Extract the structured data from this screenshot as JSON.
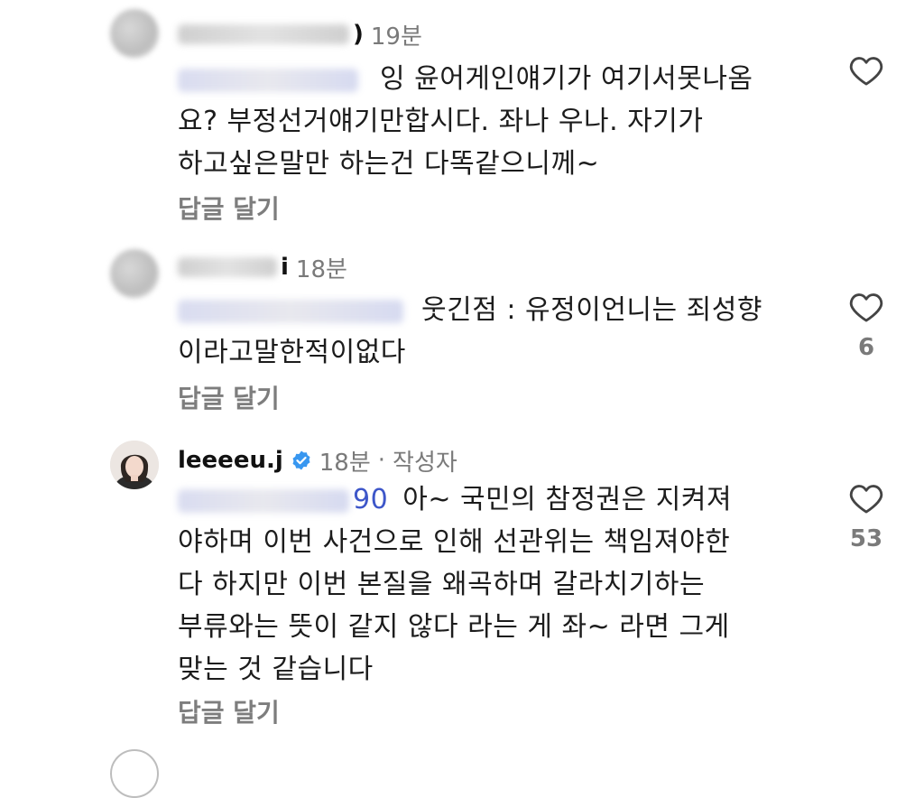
{
  "comments": [
    {
      "username_tail": ")",
      "time": "19분",
      "text_lines": [
        "잉 윤어게인얘기가 여기서못나옴",
        "요?  부정선거얘기만합시다.  좌나 우나. 자기가",
        "하고싶은말만 하는건 다똑같으니께~"
      ],
      "reply_label": "답글 달기",
      "like_count": ""
    },
    {
      "username_tail": "i",
      "time": "18분",
      "text_lines": [
        "웃긴점 : 유정이언니는 죄성향",
        "이라고말한적이없다"
      ],
      "reply_label": "답글 달기",
      "like_count": "6"
    },
    {
      "username": "leeeeu.j",
      "verified": true,
      "time": "18분",
      "separator": "·",
      "author_tag": "작성자",
      "mention_tail": "90",
      "text_lines": [
        "아~ 국민의 참정권은 지켜져",
        "야하며 이번 사건으로 인해 선관위는 책임져야한",
        "다 하지만 이번 본질을 왜곡하며 갈라치기하는",
        "부류와는 뜻이 같지 않다 라는 게 좌~ 라면 그게",
        "맞는 것 같습니다"
      ],
      "reply_label": "답글 달기",
      "like_count": "53"
    }
  ],
  "icons": {
    "like": "heart-outline-icon",
    "verified": "verified-badge-icon"
  },
  "colors": {
    "text": "#1c1c1c",
    "muted": "#7a7a7a",
    "mention": "#3d56c9",
    "verified": "#3897f0"
  }
}
